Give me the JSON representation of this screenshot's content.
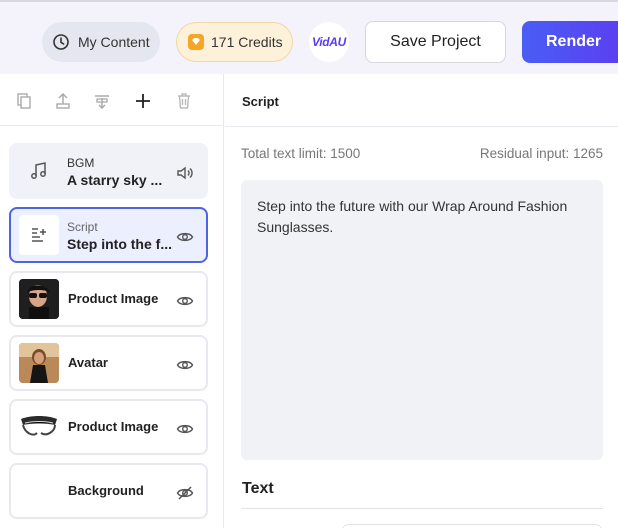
{
  "topbar": {
    "my_content_label": "My Content",
    "credits_label": "171 Credits",
    "logo_text": "VidAU",
    "save_label": "Save Project",
    "render_label": "Render",
    "accent_color": "#5a3bf0"
  },
  "toolbar": {
    "icons": [
      "copy-icon",
      "bring-up-icon",
      "align-center-icon",
      "add-icon",
      "trash-icon"
    ]
  },
  "layers": [
    {
      "kind": "BGM",
      "title": "A starry sky ...",
      "icon": "speaker-icon"
    },
    {
      "kind": "Script",
      "title": "Step into the f...",
      "icon": "eye-icon"
    },
    {
      "title": "Product Image",
      "icon": "eye-icon"
    },
    {
      "title": "Avatar",
      "icon": "eye-icon"
    },
    {
      "title": "Product Image",
      "icon": "eye-icon"
    },
    {
      "title": "Background",
      "icon": "eye-off-icon"
    }
  ],
  "script_panel": {
    "heading": "Script",
    "total_limit": "Total text limit: 1500",
    "residual": "Residual input: 1265",
    "content": "Step into the future with our Wrap Around Fashion Sunglasses.",
    "text_heading": "Text"
  }
}
